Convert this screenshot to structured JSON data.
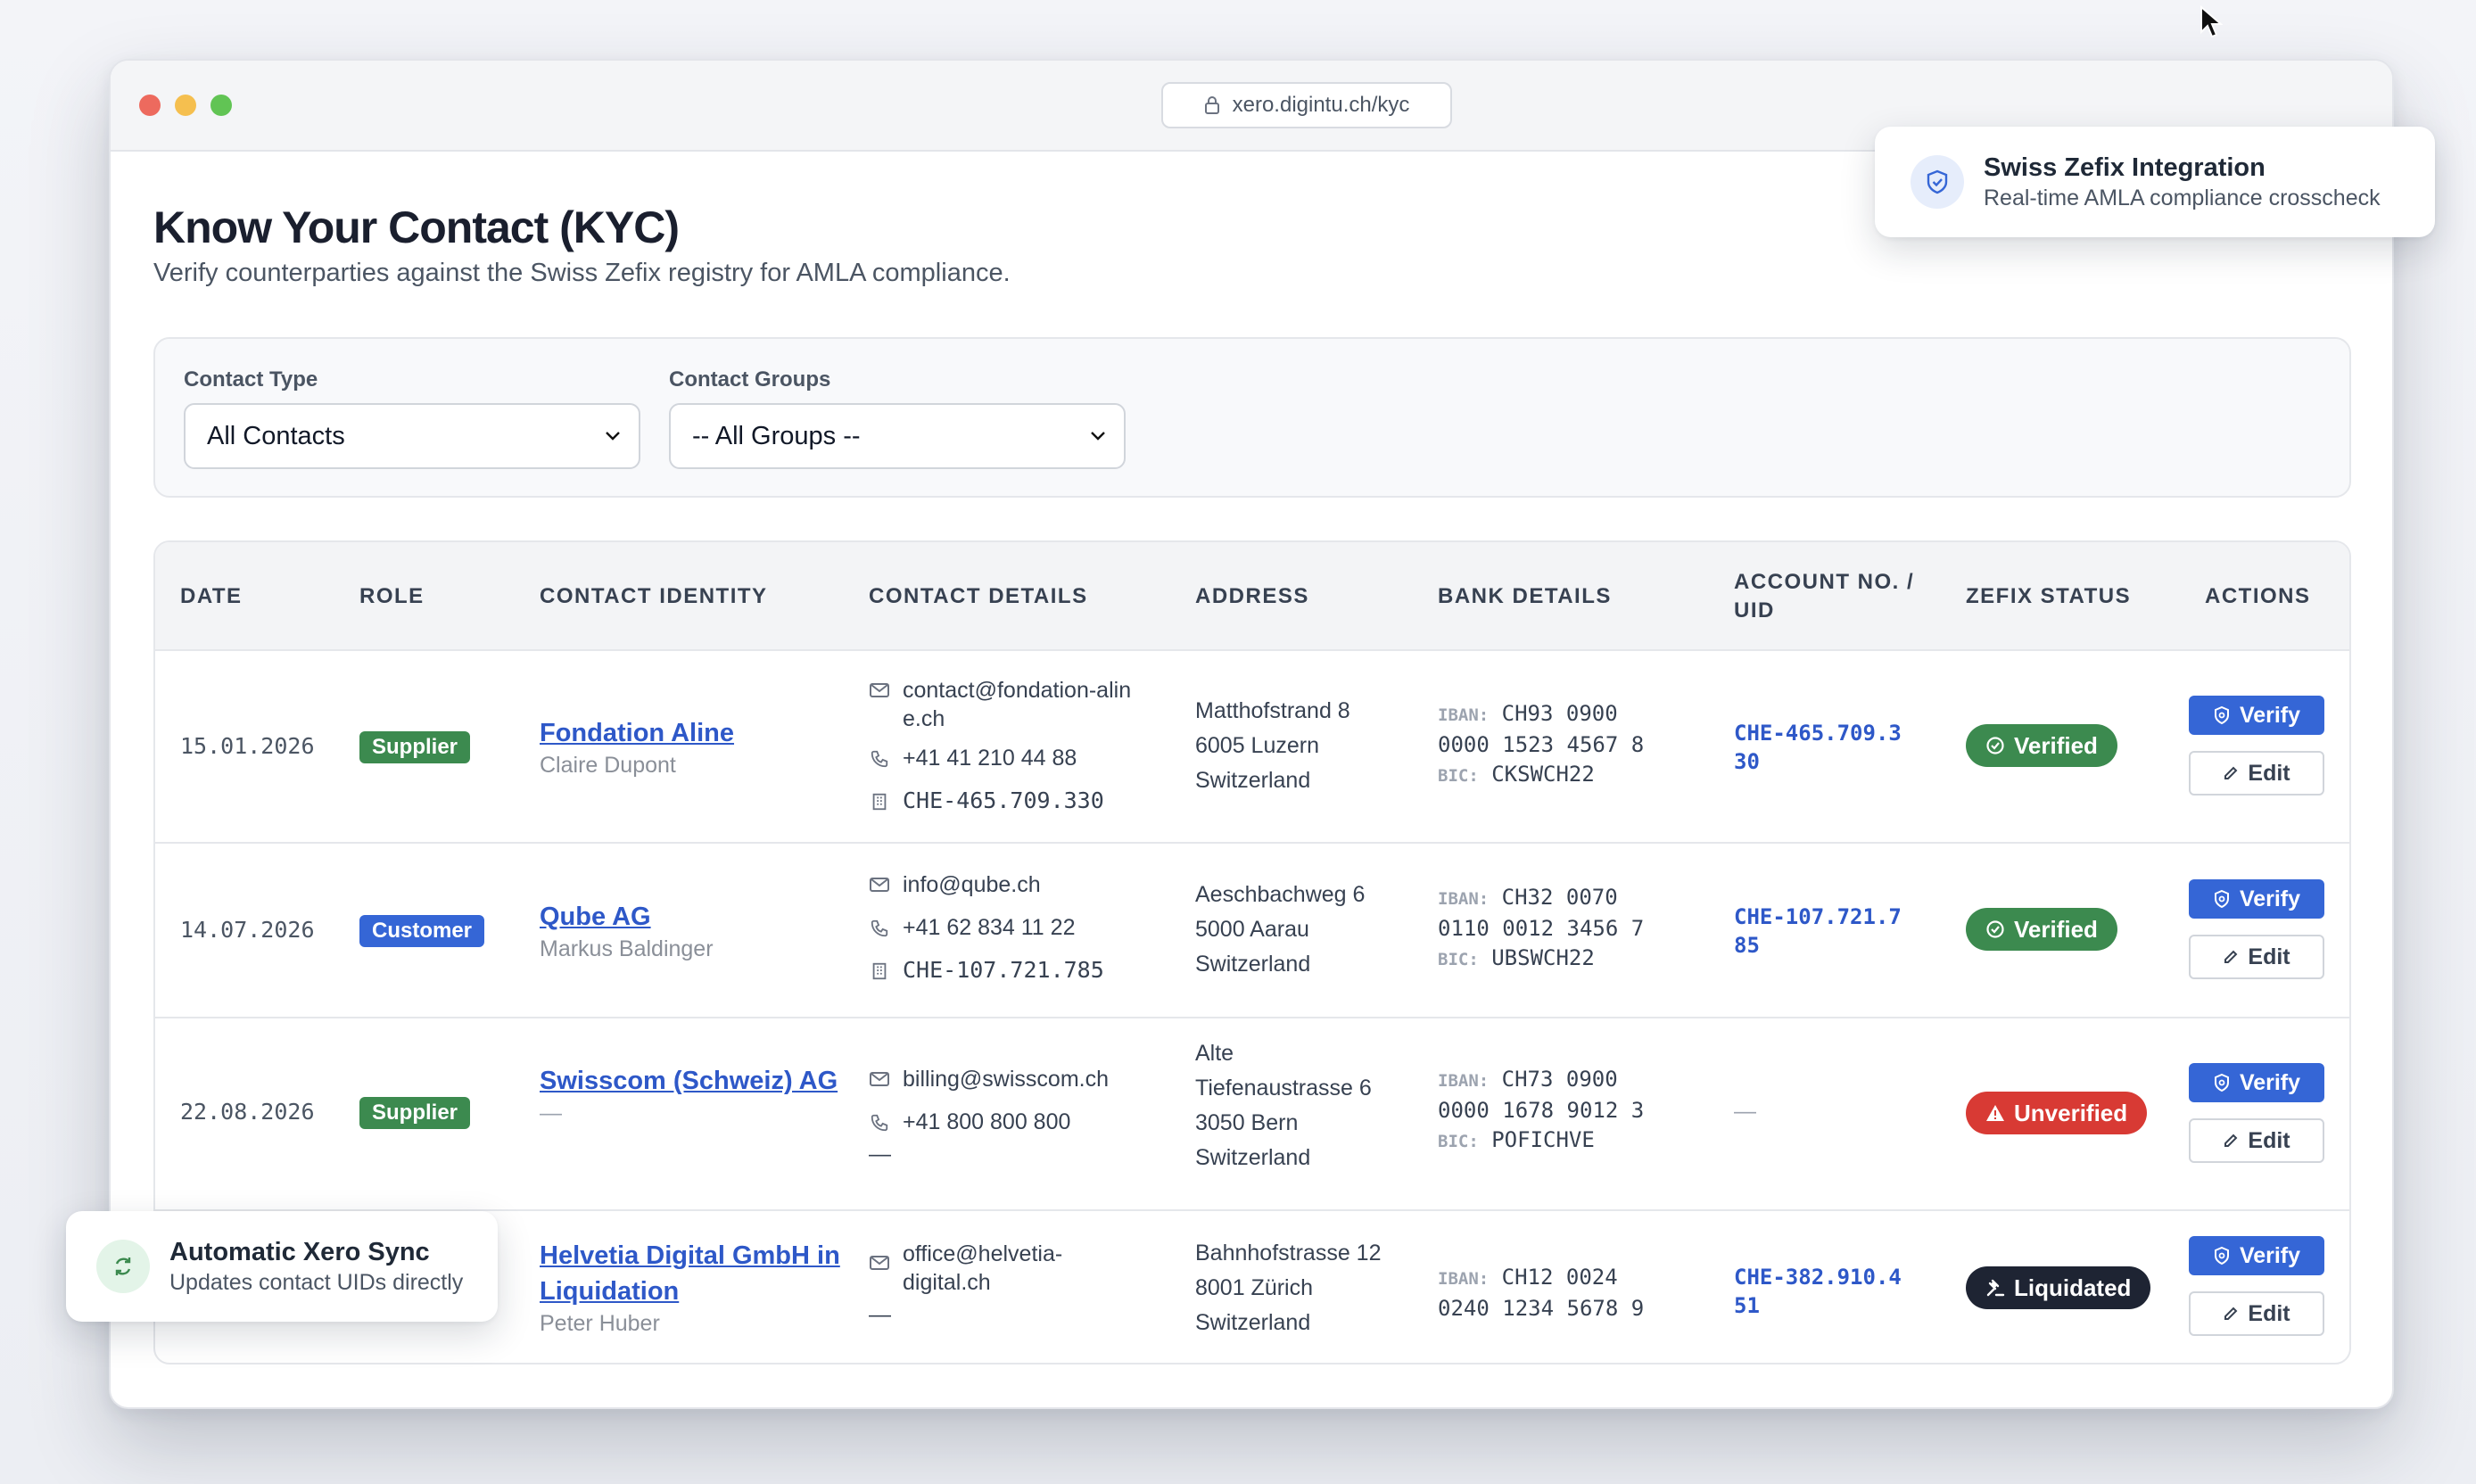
{
  "browser": {
    "url": "xero.digintu.ch/kyc"
  },
  "page": {
    "title": "Know Your Contact (KYC)",
    "subtitle": "Verify counterparties against the Swiss Zefix registry for AMLA compliance."
  },
  "filters": {
    "contact_type": {
      "label": "Contact Type",
      "value": "All Contacts"
    },
    "contact_groups": {
      "label": "Contact Groups",
      "value": "-- All Groups --"
    }
  },
  "table": {
    "headers": {
      "date": "DATE",
      "role": "ROLE",
      "identity": "CONTACT IDENTITY",
      "details": "CONTACT DETAILS",
      "address": "ADDRESS",
      "bank": "BANK DETAILS",
      "account": "ACCOUNT NO. / UID",
      "status": "ZEFIX STATUS",
      "actions": "ACTIONS"
    },
    "iban_label": "IBAN:",
    "bic_label": "BIC:",
    "verify_label": "Verify",
    "edit_label": "Edit",
    "rows": [
      {
        "date": "15.01.2026",
        "role": "Supplier",
        "name": "Fondation Aline",
        "person": "Claire Dupont",
        "email": "contact@fondation-aline.ch",
        "phone": "+41 41 210 44 88",
        "uid": "CHE-465.709.330",
        "address": [
          "Matthofstrand 8",
          "6005 Luzern",
          "Switzerland"
        ],
        "iban": [
          "CH93 0900",
          "0000 1523 4567 8"
        ],
        "bic": "CKSWCH22",
        "account": "CHE-465.709.330",
        "status": "Verified"
      },
      {
        "date": "14.07.2026",
        "role": "Customer",
        "name": "Qube AG",
        "person": "Markus Baldinger",
        "email": "info@qube.ch",
        "phone": "+41 62 834 11 22",
        "uid": "CHE-107.721.785",
        "address": [
          "Aeschbachweg 6",
          "5000 Aarau",
          "Switzerland"
        ],
        "iban": [
          "CH32 0070",
          "0110 0012 3456 7"
        ],
        "bic": "UBSWCH22",
        "account": "CHE-107.721.785",
        "status": "Verified"
      },
      {
        "date": "22.08.2026",
        "role": "Supplier",
        "name": "Swisscom (Schweiz) AG",
        "person": "—",
        "email": "billing@swisscom.ch",
        "phone": "+41 800 800 800",
        "uid": "—",
        "address": [
          "Alte",
          "Tiefenaustrasse 6",
          "3050 Bern",
          "Switzerland"
        ],
        "iban": [
          "CH73 0900",
          "0000 1678 9012 3"
        ],
        "bic": "POFICHVE",
        "account": "—",
        "status": "Unverified"
      },
      {
        "date": "",
        "role": "",
        "name": "Helvetia Digital GmbH in Liquidation",
        "person": "Peter Huber",
        "email": "office@helvetia-digital.ch",
        "phone": "—",
        "uid": "",
        "address": [
          "Bahnhofstrasse 12",
          "8001 Zürich",
          "Switzerland"
        ],
        "iban": [
          "CH12 0024",
          "0240 1234 5678 9"
        ],
        "bic": "",
        "account": "CHE-382.910.451",
        "status": "Liquidated"
      }
    ]
  },
  "toasts": {
    "zefix": {
      "title": "Swiss Zefix Integration",
      "desc": "Real-time AMLA compliance crosscheck"
    },
    "sync": {
      "title": "Automatic Xero Sync",
      "desc": "Updates contact UIDs directly"
    }
  },
  "colors": {
    "primary": "#3566d6",
    "verified": "#3c8a4f",
    "unverified": "#d83a34",
    "liquidated": "#1e2433"
  }
}
